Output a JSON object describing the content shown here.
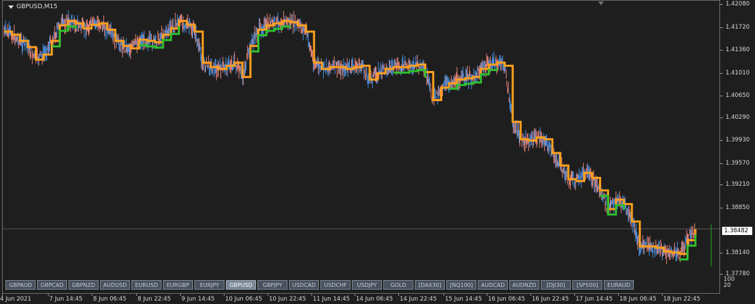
{
  "window": {
    "title": "GBPUSD,M15"
  },
  "y_axis": {
    "labels": [
      "1.42080",
      "1.41720",
      "1.41360",
      "1.41010",
      "1.40650",
      "1.40290",
      "1.39930",
      "1.39570",
      "1.39210",
      "1.38850",
      "1.38140",
      "1.37780"
    ],
    "current_price": "1.38482"
  },
  "x_axis": {
    "labels": [
      "4 Jun 2021",
      "7 Jun 14:45",
      "8 Jun 06:45",
      "8 Jun 22:45",
      "9 Jun 14:45",
      "10 Jun 06:45",
      "10 Jun 22:45",
      "11 Jun 14:45",
      "14 Jun 06:45",
      "14 Jun 22:45",
      "15 Jun 14:45",
      "16 Jun 06:45",
      "16 Jun 22:45",
      "17 Jun 14:45",
      "18 Jun 06:45",
      "18 Jun 22:45"
    ]
  },
  "indicator_scale": {
    "top": "100",
    "bottom": "20"
  },
  "symbols": [
    "GBPAUD",
    "GBPCAD",
    "GBPNZD",
    "AUDUSD",
    "EURUSD",
    "EURGBP",
    "EURJPY",
    "GBPUSD",
    "GBPJPY",
    "USDCAD",
    "USDCHF",
    "USDJPY",
    "GOLD",
    "[DAX30]",
    "[NQ100]",
    "AUDCAD",
    "AUDNZD",
    "[DJI30]",
    "[SP500]",
    "EURAUD"
  ],
  "active_symbol": "GBPUSD",
  "colors": {
    "background": "#1e1e1e",
    "bull": "#4a90e2",
    "bear": "#e8867a",
    "trail_up": "#2fbf2f",
    "trail_down": "#ffa01e",
    "signal": "#1faa1f"
  },
  "chart_data": {
    "type": "line",
    "title": "GBPUSD,M15",
    "ylim": [
      1.3778,
      1.4208
    ],
    "series": [
      {
        "name": "",
        "values": [
          1.4165,
          1.416,
          1.415,
          1.414,
          1.412,
          1.4128,
          1.415,
          1.4175,
          1.4182,
          1.4178,
          1.417,
          1.4176,
          1.4178,
          1.4168,
          1.415,
          1.4142,
          1.4138,
          1.4152,
          1.415,
          1.4148,
          1.416,
          1.417,
          1.4182,
          1.4176,
          1.4165,
          1.4115,
          1.4108,
          1.4105,
          1.411,
          1.4115,
          1.4092,
          1.4142,
          1.4168,
          1.4175,
          1.4178,
          1.4182,
          1.418,
          1.4175,
          1.4165,
          1.4115,
          1.4105,
          1.4108,
          1.4108,
          1.4105,
          1.4108,
          1.411,
          1.4088,
          1.4098,
          1.4105,
          1.4108,
          1.4108,
          1.411,
          1.4112,
          1.41,
          1.4055,
          1.4075,
          1.4082,
          1.4088,
          1.409,
          1.4092,
          1.4105,
          1.4112,
          1.4115,
          1.411,
          1.402,
          1.3992,
          1.399,
          1.3995,
          1.3992,
          1.397,
          1.395,
          1.3928,
          1.3925,
          1.3938,
          1.393,
          1.391,
          1.388,
          1.3895,
          1.3888,
          1.386,
          1.382,
          1.382,
          1.3818,
          1.3812,
          1.381,
          1.3808,
          1.383,
          1.3848
        ]
      }
    ]
  }
}
